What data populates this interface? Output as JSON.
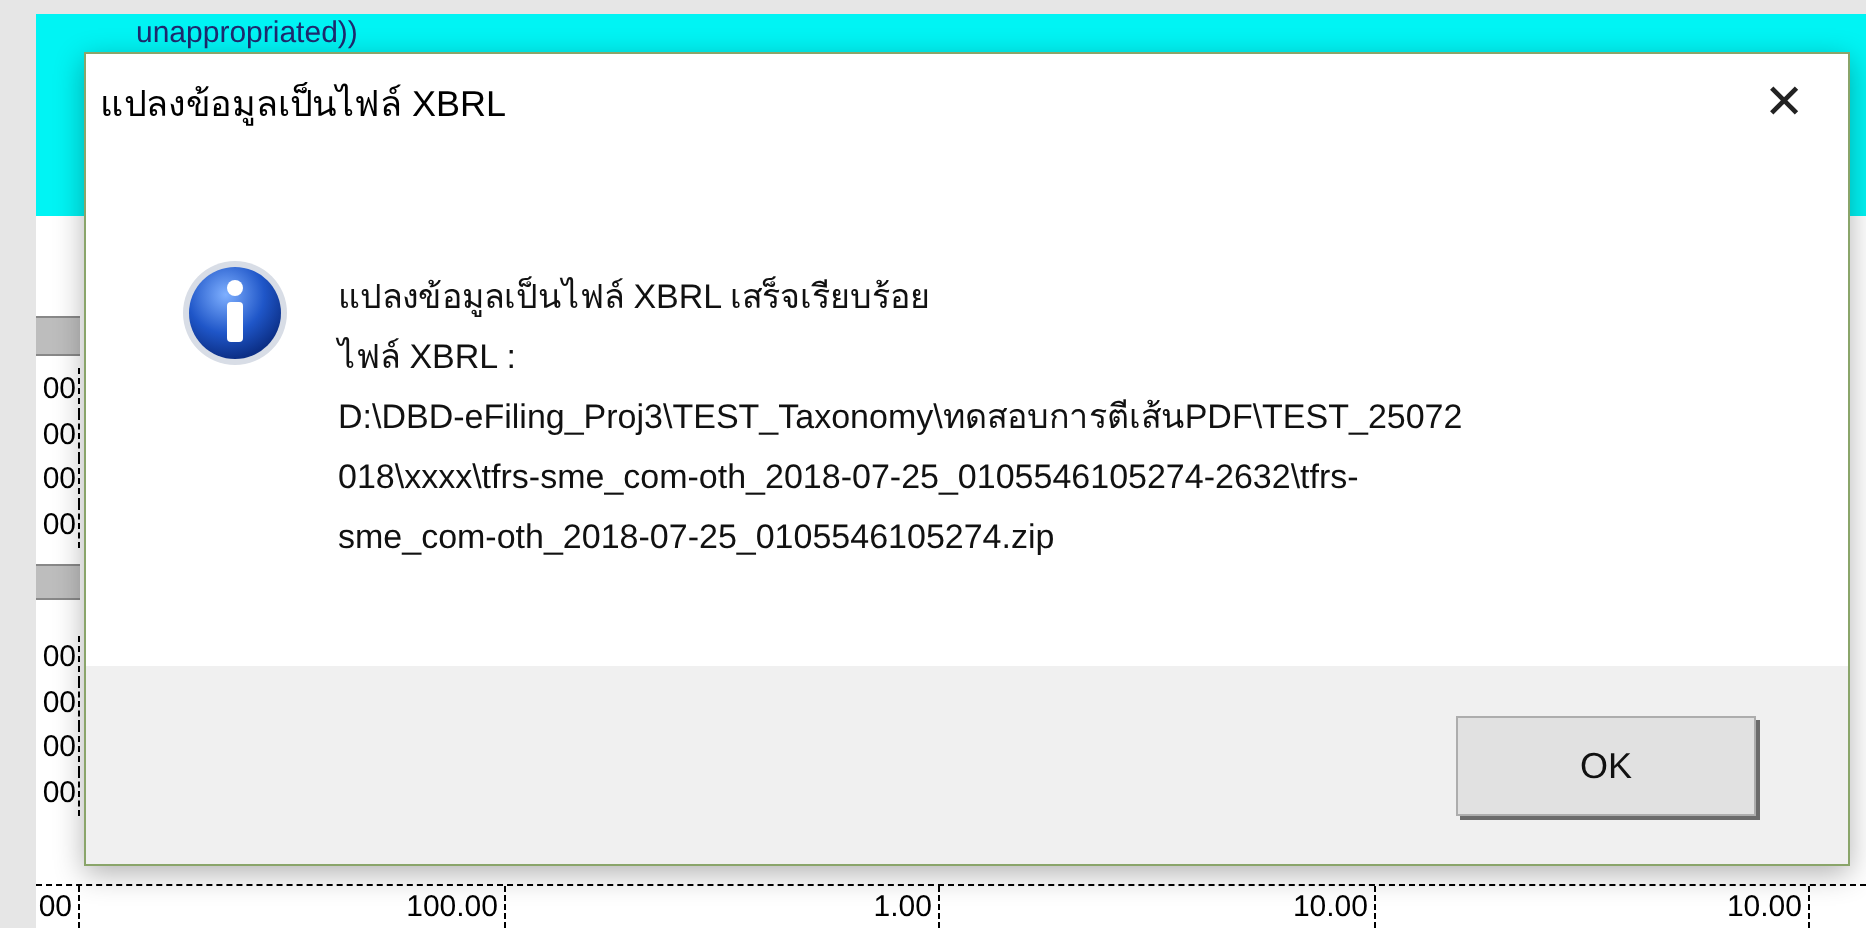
{
  "sheet": {
    "header_cell": "unappropriated))",
    "left_cells": [
      "00",
      "00",
      "00",
      "00",
      "00",
      "00",
      "00",
      "00"
    ],
    "bottom_row": [
      "00",
      "100.00",
      "1.00",
      "10.00",
      "10.00"
    ]
  },
  "dialog": {
    "title": "แปลงข้อมูลเป็นไฟล์ XBRL",
    "close": "✕",
    "message_lines": [
      "แปลงข้อมูลเป็นไฟล์ XBRL เสร็จเรียบร้อย",
      "ไฟล์ XBRL :",
      "D:\\DBD-eFiling_Proj3\\TEST_Taxonomy\\ทดสอบการตีเส้นPDF\\TEST_25072",
      "018\\xxxx\\tfrs-sme_com-oth_2018-07-25_0105546105274-2632\\tfrs-",
      "sme_com-oth_2018-07-25_0105546105274.zip"
    ],
    "buttons": [
      "OK"
    ]
  }
}
